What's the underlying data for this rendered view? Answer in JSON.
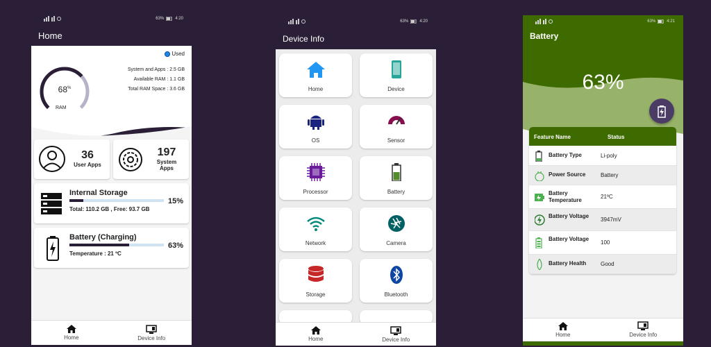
{
  "status_bar": {
    "left_1": "2G 4G",
    "right_1": "63%",
    "time_1": "4:20",
    "time_2": "4:20",
    "time_3": "4:21"
  },
  "home": {
    "title": "Home",
    "used_label": "Used",
    "ram_percent": "68",
    "ram_percent_sign": "%",
    "ram_label": "RAM",
    "ram_fraction": 0.68,
    "system_apps_line": "System and Apps : 2.5 GB",
    "available_ram_line": "Available RAM : 1.1 GB",
    "total_ram_line": "Total RAM Space : 3.6 GB",
    "user_apps_count": "36",
    "user_apps_label": "User Apps",
    "system_apps_count": "197",
    "system_apps_label_1": "System",
    "system_apps_label_2": "Apps",
    "storage_title": "Internal Storage",
    "storage_detail": "Total:  110.2 GB ,  Free: 93.7 GB",
    "storage_percent": "15%",
    "storage_fraction": 0.15,
    "battery_title": "Battery (Charging)",
    "battery_detail": "Temperature : 21 ºC",
    "battery_percent": "63%",
    "battery_fraction": 0.63,
    "nav": {
      "home": "Home",
      "device_info": "Device Info"
    }
  },
  "device_info": {
    "title": "Device Info",
    "tiles": [
      {
        "label": "Home",
        "icon": "home-icon",
        "color": "#2196f3"
      },
      {
        "label": "Device",
        "icon": "phone-icon",
        "color": "#26a69a"
      },
      {
        "label": "OS",
        "icon": "android-icon",
        "color": "#1a237e"
      },
      {
        "label": "Sensor",
        "icon": "gauge-icon",
        "color": "#880e4f"
      },
      {
        "label": "Processor",
        "icon": "cpu-icon",
        "color": "#6a1b9a"
      },
      {
        "label": "Battery",
        "icon": "battery-icon",
        "color": "#558b2f"
      },
      {
        "label": "Network",
        "icon": "wifi-icon",
        "color": "#00897b"
      },
      {
        "label": "Camera",
        "icon": "camera-aperture-icon",
        "color": "#006064"
      },
      {
        "label": "Storage",
        "icon": "database-icon",
        "color": "#c62828"
      },
      {
        "label": "Bluetooth",
        "icon": "bluetooth-icon",
        "color": "#0d47a1"
      }
    ],
    "nav": {
      "home": "Home",
      "device_info": "Device Info"
    }
  },
  "battery": {
    "title": "Battery",
    "percent": "63%",
    "header_feature": "Feature Name",
    "header_status": "Status",
    "rows": [
      {
        "name": "Battery Type",
        "value": "Li-poly",
        "icon": "battery-outline-icon"
      },
      {
        "name": "Power Source",
        "value": "Battery",
        "icon": "plug-icon"
      },
      {
        "name": "Battery Temperature",
        "value": "21ºC",
        "icon": "battery-temp-icon"
      },
      {
        "name": "Battery Voltage",
        "value": "3947mV",
        "icon": "bolt-icon"
      },
      {
        "name": "Battery Voltage",
        "value": "100",
        "icon": "battery-level-icon"
      },
      {
        "name": "Battery Health",
        "value": "Good",
        "icon": "drop-icon"
      }
    ],
    "accent": "#3e6b00",
    "nav": {
      "home": "Home",
      "device_info": "Device Info"
    }
  }
}
